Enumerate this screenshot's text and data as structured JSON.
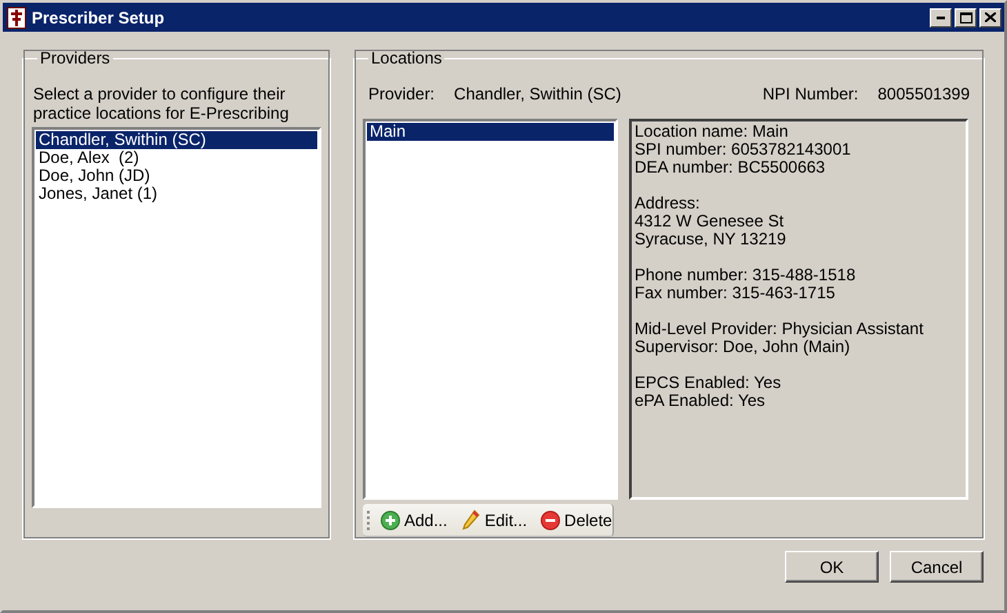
{
  "window": {
    "title": "Prescriber Setup"
  },
  "providers": {
    "title": "Providers",
    "instructions": "Select a provider to configure their practice locations for E-Prescribing",
    "items": [
      {
        "label": "Chandler, Swithin (SC)",
        "selected": true
      },
      {
        "label": "Doe, Alex  (2)",
        "selected": false
      },
      {
        "label": "Doe, John (JD)",
        "selected": false
      },
      {
        "label": "Jones, Janet (1)",
        "selected": false
      }
    ]
  },
  "locations": {
    "title": "Locations",
    "provider_label": "Provider:",
    "provider_value": "Chandler, Swithin (SC)",
    "npi_label": "NPI Number:",
    "npi_value": "8005501399",
    "items": [
      {
        "label": "Main",
        "selected": true
      }
    ],
    "toolbar": [
      {
        "kind": "add",
        "label": "Add..."
      },
      {
        "kind": "edit",
        "label": "Edit..."
      },
      {
        "kind": "delete",
        "label": "Delete"
      }
    ],
    "details": [
      [
        "Location name: Main",
        "SPI number: 6053782143001",
        "DEA number: BC5500663"
      ],
      [
        "Address:",
        "4312 W Genesee St",
        "Syracuse, NY 13219"
      ],
      [
        "Phone number: 315-488-1518",
        "Fax number: 315-463-1715"
      ],
      [
        "Mid-Level Provider: Physician Assistant",
        "Supervisor: Doe, John (Main)"
      ],
      [
        "EPCS Enabled: Yes",
        "ePA Enabled: Yes"
      ]
    ]
  },
  "buttons": [
    "OK",
    "Cancel"
  ]
}
